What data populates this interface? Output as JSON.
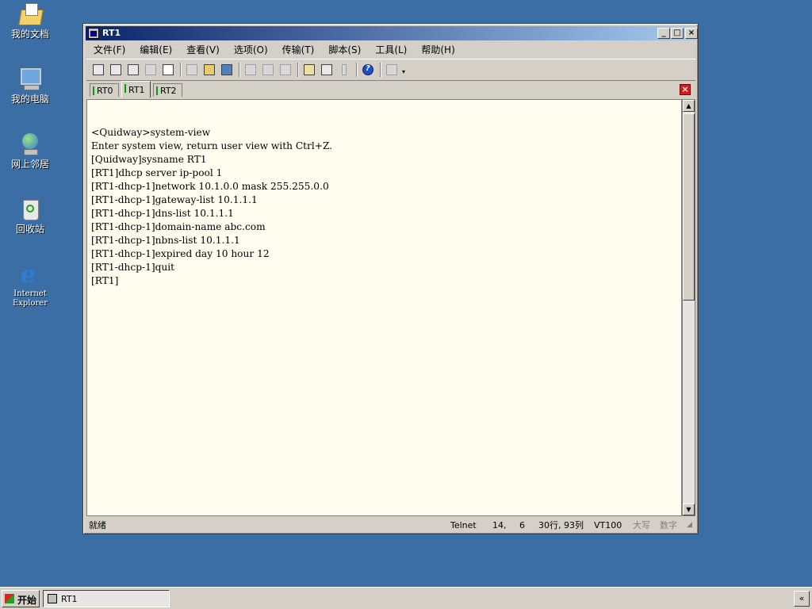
{
  "desktop": {
    "icons": [
      {
        "label": "我的文档",
        "icon": "my-documents-icon"
      },
      {
        "label": "我的电脑",
        "icon": "my-computer-icon"
      },
      {
        "label": "网上邻居",
        "icon": "network-places-icon"
      },
      {
        "label": "回收站",
        "icon": "recycle-bin-icon"
      },
      {
        "label": "Internet Explorer",
        "icon": "internet-explorer-icon"
      }
    ]
  },
  "window": {
    "title": "RT1",
    "menus": [
      "文件(F)",
      "编辑(E)",
      "查看(V)",
      "选项(O)",
      "传输(T)",
      "脚本(S)",
      "工具(L)",
      "帮助(H)"
    ],
    "tabs": [
      "RT0",
      "RT1",
      "RT2"
    ],
    "active_tab": "RT1",
    "terminal_lines": [
      "<Quidway>system-view",
      "Enter system view, return user view with Ctrl+Z.",
      "[Quidway]sysname RT1",
      "[RT1]dhcp server ip-pool 1",
      "[RT1-dhcp-1]network 10.1.0.0 mask 255.255.0.0",
      "[RT1-dhcp-1]gateway-list 10.1.1.1",
      "[RT1-dhcp-1]dns-list 10.1.1.1",
      "[RT1-dhcp-1]domain-name abc.com",
      "[RT1-dhcp-1]nbns-list 10.1.1.1",
      "[RT1-dhcp-1]expired day 10 hour 12",
      "[RT1-dhcp-1]quit",
      "[RT1]"
    ],
    "status": {
      "ready": "就绪",
      "protocol": "Telnet",
      "row": "14,",
      "col": "6",
      "size": "30行, 93列",
      "terminal": "VT100",
      "caps": "大写",
      "num": "数字"
    }
  },
  "taskbar": {
    "start": "开始",
    "task": "RT1",
    "tray": "«"
  },
  "colors": {
    "desktop": "#3a6ea5",
    "terminal_bg": "#fefdf0",
    "titlebar": "#0a246a"
  }
}
